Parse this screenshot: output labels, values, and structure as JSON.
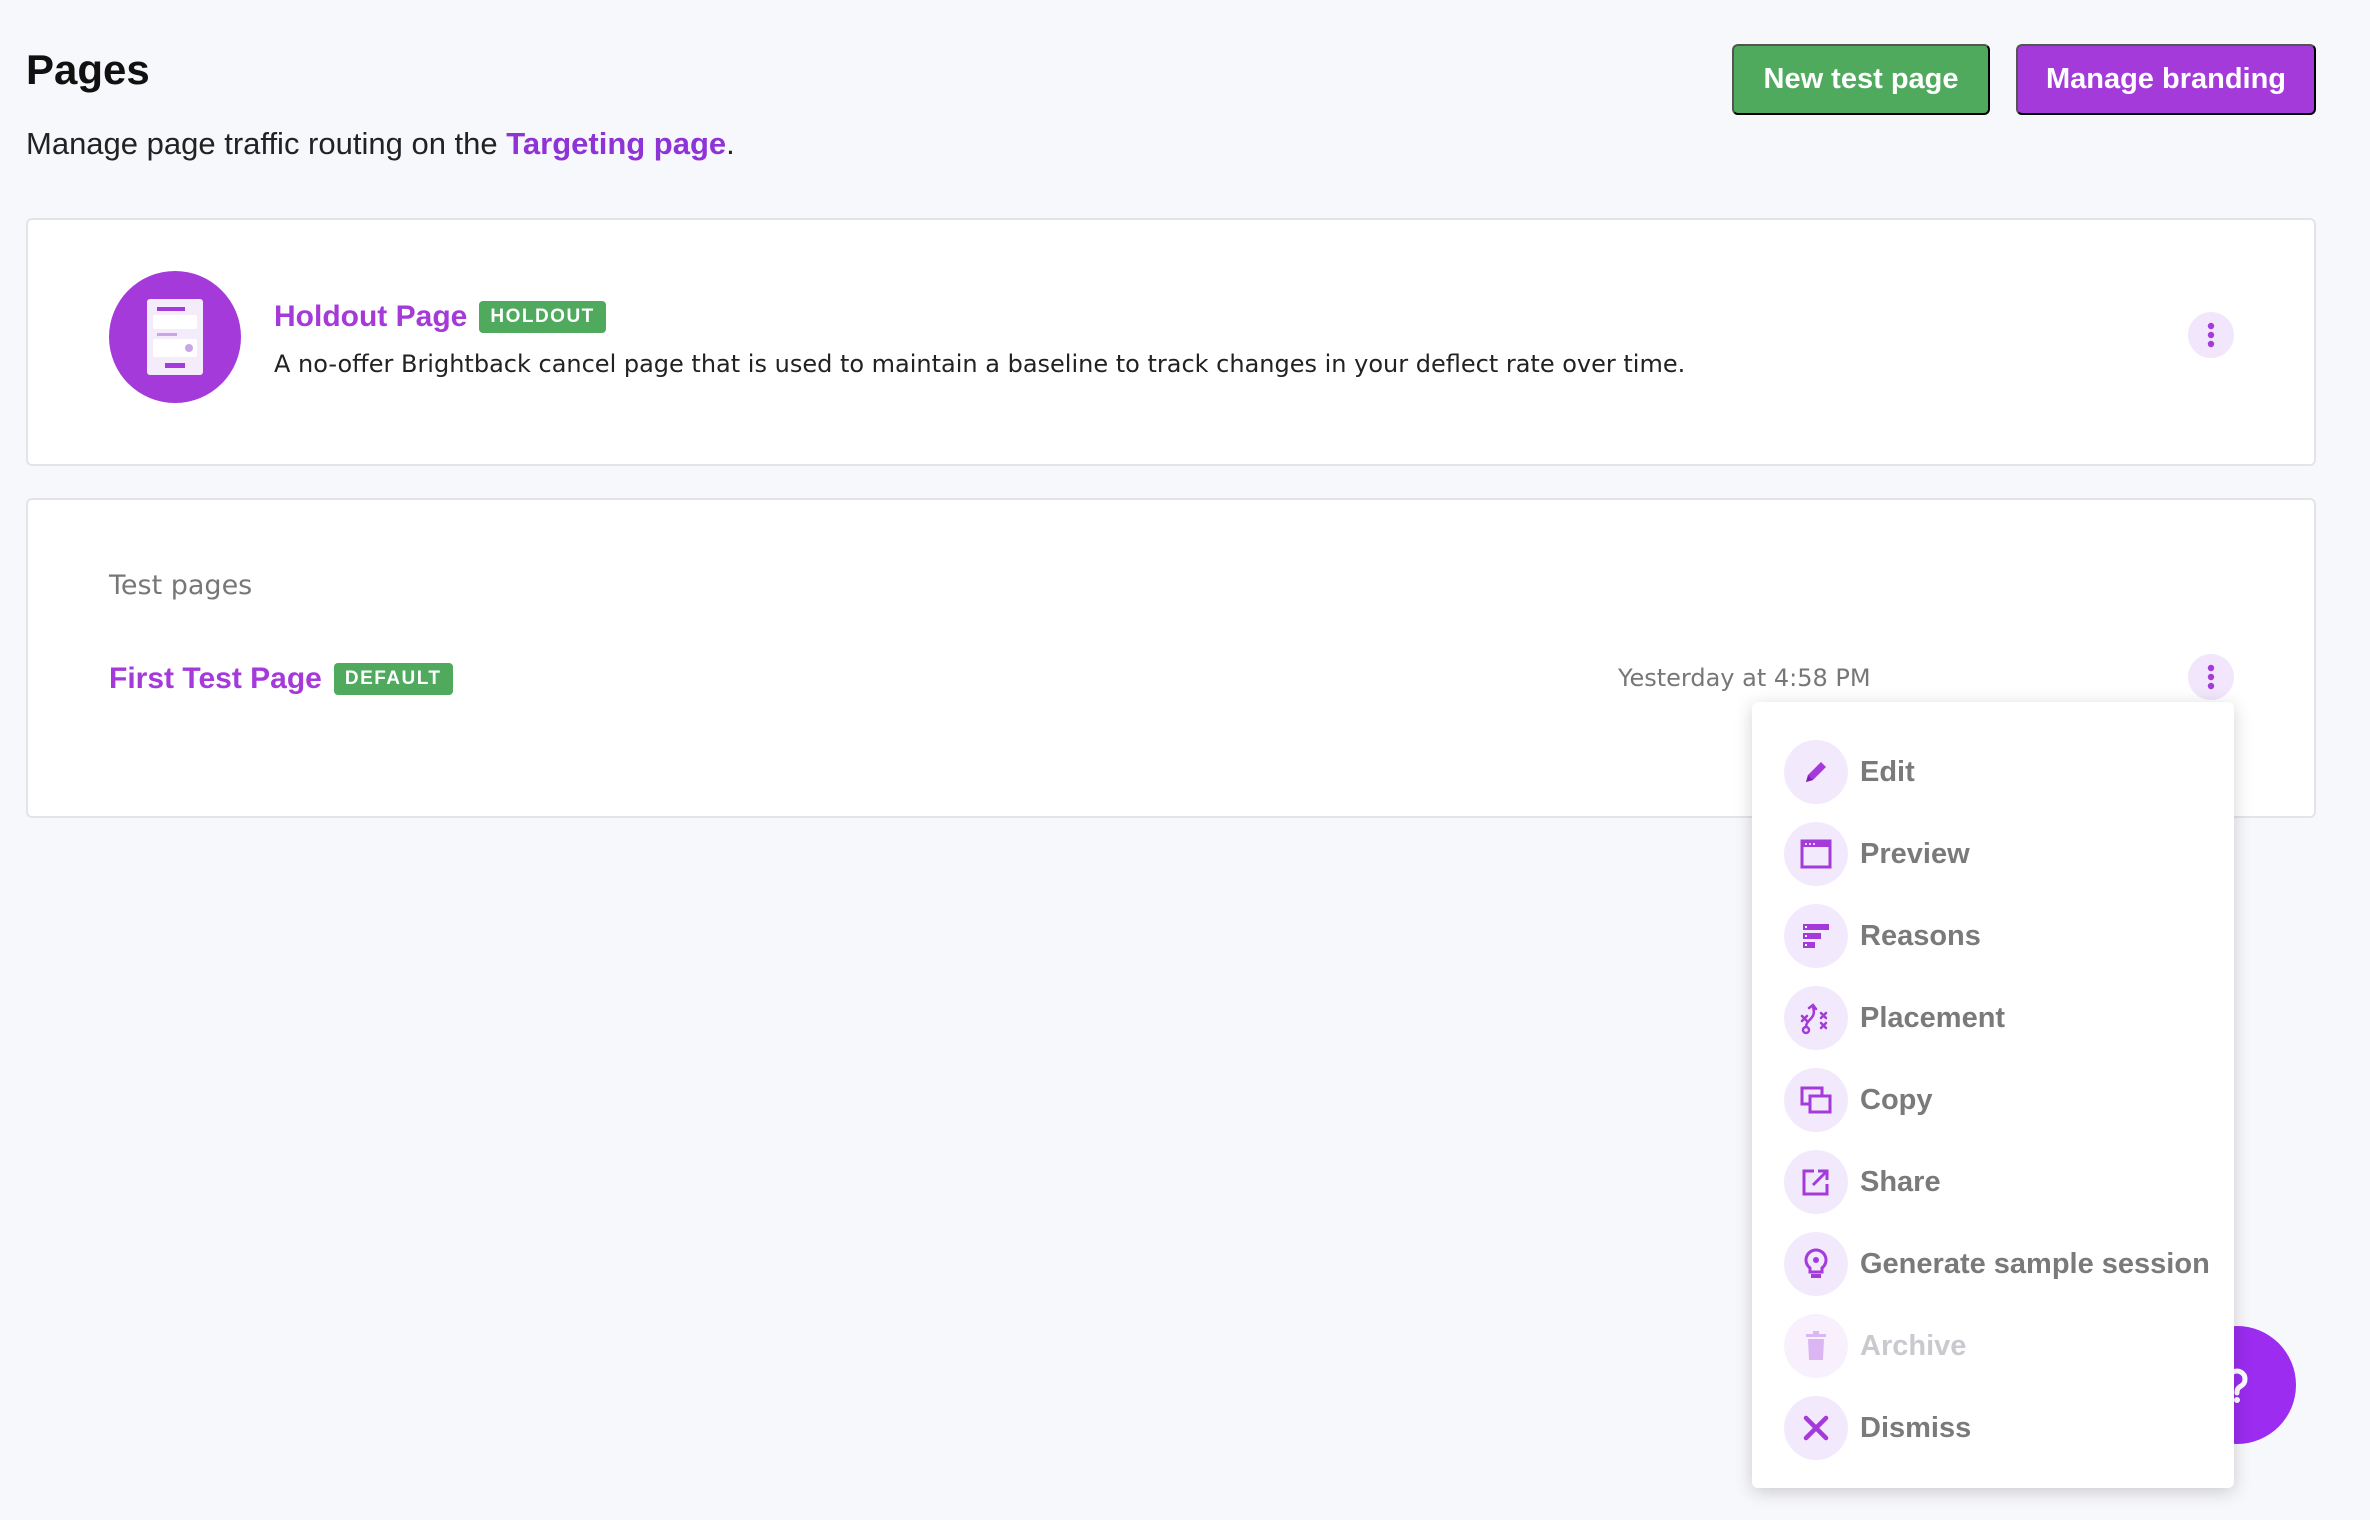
{
  "header": {
    "title": "Pages",
    "subtitle_prefix": "Manage page traffic routing on the ",
    "subtitle_link": "Targeting page",
    "subtitle_suffix": ".",
    "new_test_page_label": "New test page",
    "manage_branding_label": "Manage branding"
  },
  "holdout": {
    "name": "Holdout Page",
    "badge": "HOLDOUT",
    "description": "A no-offer Brightback cancel page that is used to maintain a baseline to track changes in your deflect rate over time.",
    "icon": "page-preview-icon"
  },
  "test_pages": {
    "section_label": "Test pages",
    "items": [
      {
        "name": "First Test Page",
        "badge": "DEFAULT",
        "timestamp": "Yesterday at 4:58 PM"
      }
    ]
  },
  "menu": {
    "items": [
      {
        "label": "Edit",
        "icon": "pencil-icon",
        "disabled": false
      },
      {
        "label": "Preview",
        "icon": "browser-window-icon",
        "disabled": false
      },
      {
        "label": "Reasons",
        "icon": "list-bars-icon",
        "disabled": false
      },
      {
        "label": "Placement",
        "icon": "strategy-icon",
        "disabled": false
      },
      {
        "label": "Copy",
        "icon": "copy-icon",
        "disabled": false
      },
      {
        "label": "Share",
        "icon": "share-icon",
        "disabled": false
      },
      {
        "label": "Generate sample session",
        "icon": "lightbulb-icon",
        "disabled": false
      },
      {
        "label": "Archive",
        "icon": "trash-icon",
        "disabled": true
      },
      {
        "label": "Dismiss",
        "icon": "close-icon",
        "disabled": false
      }
    ]
  },
  "colors": {
    "accent": "#a43ad9",
    "success": "#4faa5e",
    "background": "#f7f8fb"
  }
}
